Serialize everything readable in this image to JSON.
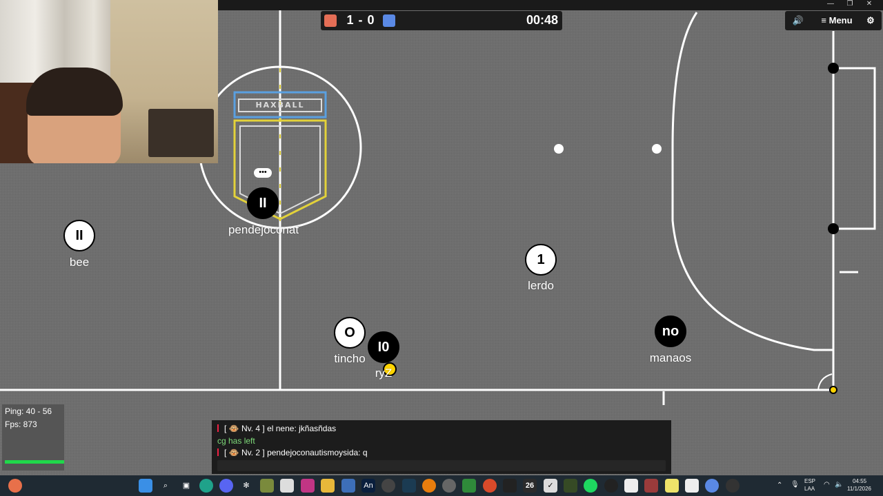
{
  "scoreboard": {
    "red_color": "#e56e56",
    "blue_color": "#5a89e5",
    "score": "1 - 0",
    "timer": "00:48"
  },
  "controls": {
    "sound_icon": "speaker-icon",
    "menu_label": "≡ Menu",
    "settings_icon": "gear-icon"
  },
  "players": [
    {
      "name": "pendejoconat",
      "avatar": "II",
      "team": "blue"
    },
    {
      "name": "bee",
      "avatar": "II",
      "team": "red"
    },
    {
      "name": "lerdo",
      "avatar": "1",
      "team": "red"
    },
    {
      "name": "tincho",
      "avatar": "O",
      "team": "red"
    },
    {
      "name": "ryZ",
      "avatar": "I0",
      "team": "blue"
    },
    {
      "name": "manaos",
      "avatar": "no",
      "team": "blue"
    }
  ],
  "typing_indicator": "•••",
  "stats": {
    "ping": "Ping: 40 - 56",
    "fps": "Fps: 873"
  },
  "chat": [
    {
      "badge": "[ 🐵 Nv. 4 ]",
      "text": "el nene: jkñasñdas"
    },
    {
      "text": "cg has left",
      "system": true
    },
    {
      "badge": "[ 🐵 Nv. 2 ]",
      "text": "pendejoconautismoysida: q"
    }
  ],
  "taskbar": {
    "lang": "ESP",
    "lang2": "LAA",
    "time": "04:55",
    "date": "11/1/2026",
    "badge": "26"
  },
  "logo_text": "HAXBALL"
}
